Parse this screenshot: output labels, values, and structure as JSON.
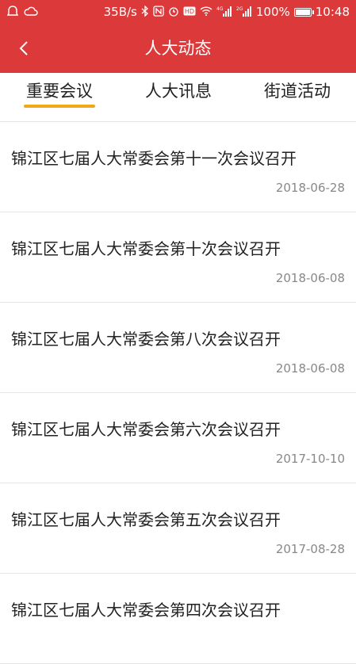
{
  "status_bar": {
    "net_speed": "35B/s",
    "battery": "100%",
    "time": "10:48",
    "network_label_1": "4G",
    "network_label_2": "2G"
  },
  "header": {
    "title": "人大动态",
    "color": "#dc3a3a"
  },
  "tabs": [
    {
      "label": "重要会议",
      "active": true
    },
    {
      "label": "人大讯息",
      "active": false
    },
    {
      "label": "街道活动",
      "active": false
    }
  ],
  "indicator_color": "#f0a81a",
  "news": [
    {
      "title": "锦江区七届人大常委会第十一次会议召开",
      "date": "2018-06-28"
    },
    {
      "title": "锦江区七届人大常委会第十次会议召开",
      "date": "2018-06-08"
    },
    {
      "title": "锦江区七届人大常委会第八次会议召开",
      "date": "2018-06-08"
    },
    {
      "title": "锦江区七届人大常委会第六次会议召开",
      "date": "2017-10-10"
    },
    {
      "title": "锦江区七届人大常委会第五次会议召开",
      "date": "2017-08-28"
    },
    {
      "title": "锦江区七届人大常委会第四次会议召开",
      "date": ""
    }
  ]
}
